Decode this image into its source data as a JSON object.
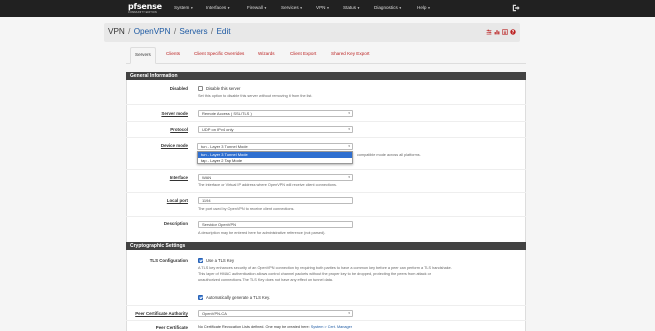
{
  "navbar": {
    "logo_text": "sense",
    "logo_prefix": "pf",
    "logo_sub": "COMMUNITY EDITION",
    "items": [
      {
        "label": "System"
      },
      {
        "label": "Interfaces"
      },
      {
        "label": "Firewall"
      },
      {
        "label": "Services"
      },
      {
        "label": "VPN"
      },
      {
        "label": "Status"
      },
      {
        "label": "Diagnostics"
      },
      {
        "label": "Help"
      }
    ]
  },
  "breadcrumb": {
    "root": "VPN",
    "level1": "OpenVPN",
    "level2": "Servers",
    "current": "Edit",
    "sep": "/"
  },
  "tabs": [
    {
      "label": "Servers"
    },
    {
      "label": "Clients"
    },
    {
      "label": "Client Specific Overrides"
    },
    {
      "label": "Wizards"
    },
    {
      "label": "Client Export"
    },
    {
      "label": "Shared Key Export"
    }
  ],
  "general": {
    "title": "General Information",
    "disabled_label": "Disabled",
    "disabled_check": "Disable this server",
    "disabled_help": "Set this option to disable this server without removing it from the list.",
    "server_mode_label": "Server mode",
    "server_mode_value": "Remote Access ( SSL/TLS )",
    "protocol_label": "Protocol",
    "protocol_value": "UDP on IPv4 only",
    "device_mode_label": "Device mode",
    "device_mode_value": "tun - Layer 3 Tunnel Mode",
    "device_mode_options": [
      "tun - Layer 3 Tunnel Mode",
      "tap - Layer 2 Tap Mode"
    ],
    "device_mode_help": "compatible mode across all platforms.",
    "interface_label": "Interface",
    "interface_value": "WAN",
    "interface_help": "The interface or Virtual IP address where OpenVPN will receive client connections.",
    "local_port_label": "Local port",
    "local_port_value": "1194",
    "local_port_help": "The port used by OpenVPN to receive client connections.",
    "description_label": "Description",
    "description_value": "Servidor OpenVPN",
    "description_help": "A description may be entered here for administrative reference (not parsed)."
  },
  "crypto": {
    "title": "Cryptographic Settings",
    "tls_label": "TLS Configuration",
    "tls_check": "Use a TLS Key",
    "tls_help_1": "A TLS key enhances security of an OpenVPN connection by requiring both parties to have a common key before a peer can perform a TLS handshake.",
    "tls_help_2": "This layer of HMAC authentication allows control channel packets without the proper key to be dropped, protecting the peers from attack or",
    "tls_help_3": "unauthorized connections.The TLS Key does not have any effect on tunnel data.",
    "auto_tls_check": "Automatically generate a TLS Key.",
    "peer_ca_label": "Peer Certificate Authority",
    "peer_ca_value": "OpenVPN-CA",
    "peer_cert_label": "Peer Certificate",
    "peer_cert_text": "No Certificate Revocation Lists defined. One may be created here:",
    "peer_cert_link": "System > Cert. Manager"
  }
}
